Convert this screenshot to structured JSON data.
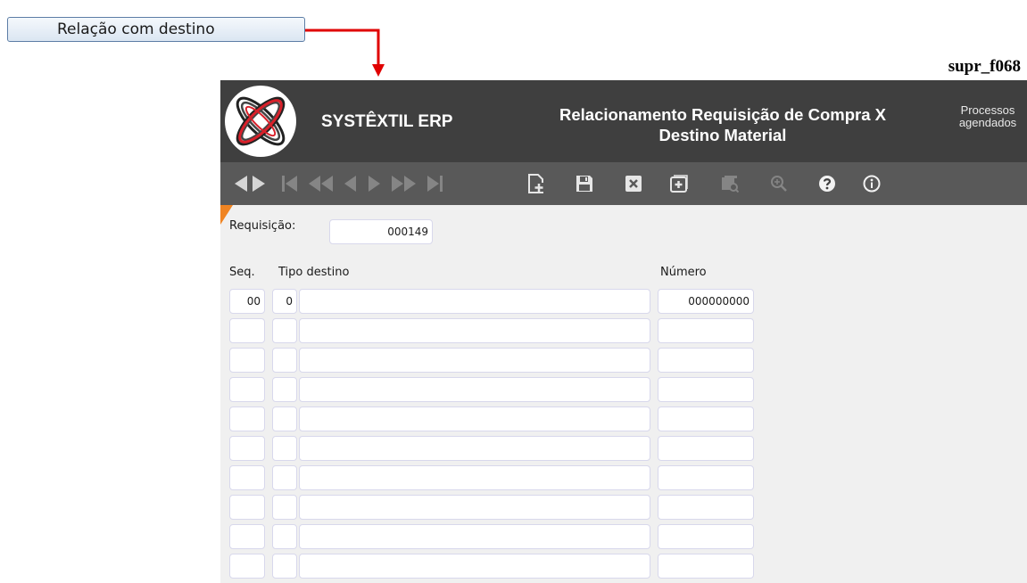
{
  "callout": {
    "button_label": "Relação com destino"
  },
  "screen_code": "supr_f068",
  "header": {
    "brand": "SYSTÊXTIL ERP",
    "title_line1": "Relacionamento Requisição de Compra X",
    "title_line2": "Destino Material",
    "scheduled_line1": "Processos",
    "scheduled_line2": "agendados"
  },
  "toolbar": {
    "buttons": [
      "previous-record",
      "next-record",
      "first",
      "fast-back",
      "back",
      "forward",
      "fast-forward",
      "last",
      "new",
      "save",
      "delete",
      "insert-line",
      "query",
      "zoom",
      "help",
      "info"
    ]
  },
  "form": {
    "requisicao_label": "Requisição:",
    "requisicao_value": "000149",
    "columns": {
      "seq": "Seq.",
      "tipo_destino": "Tipo destino",
      "numero": "Número"
    },
    "rows": [
      {
        "seq": "00",
        "tipo": "0",
        "descricao": "",
        "numero": "000000000"
      },
      {
        "seq": "",
        "tipo": "",
        "descricao": "",
        "numero": ""
      },
      {
        "seq": "",
        "tipo": "",
        "descricao": "",
        "numero": ""
      },
      {
        "seq": "",
        "tipo": "",
        "descricao": "",
        "numero": ""
      },
      {
        "seq": "",
        "tipo": "",
        "descricao": "",
        "numero": ""
      },
      {
        "seq": "",
        "tipo": "",
        "descricao": "",
        "numero": ""
      },
      {
        "seq": "",
        "tipo": "",
        "descricao": "",
        "numero": ""
      },
      {
        "seq": "",
        "tipo": "",
        "descricao": "",
        "numero": ""
      },
      {
        "seq": "",
        "tipo": "",
        "descricao": "",
        "numero": ""
      },
      {
        "seq": "",
        "tipo": "",
        "descricao": "",
        "numero": ""
      }
    ]
  },
  "colors": {
    "header_bg": "#3f3f3f",
    "toolbar_bg": "#595959",
    "accent_corner": "#f08422",
    "callout_arrow": "#e00000"
  }
}
